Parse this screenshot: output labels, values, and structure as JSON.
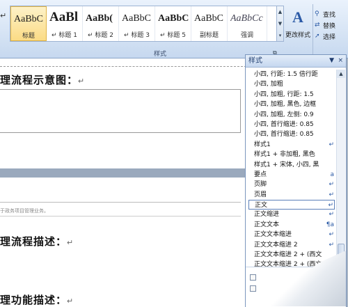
{
  "ribbon": {
    "left_glyph": "↵",
    "styles": [
      {
        "sample": "AaBbC",
        "label": "标题",
        "style": "normal"
      },
      {
        "sample": "AaBl",
        "label": "↵ 标题 1",
        "style": "big"
      },
      {
        "sample": "AaBb(",
        "label": "↵ 标题 2",
        "style": "bold"
      },
      {
        "sample": "AaBbC",
        "label": "↵ 标题 3",
        "style": "normal"
      },
      {
        "sample": "AaBbC",
        "label": "↵ 标题 5",
        "style": "bold"
      },
      {
        "sample": "AaBbC",
        "label": "副标题",
        "style": "normal"
      },
      {
        "sample": "AaBbCc",
        "label": "强调",
        "style": "ital"
      }
    ],
    "change_styles_label": "更改样式",
    "change_styles_icon": "A",
    "group_label": "样式",
    "edit": {
      "find": "查找",
      "replace": "替换",
      "select": "选择"
    }
  },
  "document": {
    "heading1": "理流程示意图：",
    "heading2": "理流程描述：",
    "heading3": "理功能描述：",
    "para_mark": "↵",
    "small_text": "于政务项目管理业务。"
  },
  "pane": {
    "title": "样式",
    "items": [
      {
        "text": "小四, 行距: 1.5 倍行距",
        "mark": ""
      },
      {
        "text": "小四, 加粗",
        "mark": ""
      },
      {
        "text": "小四, 加粗, 行距: 1.5",
        "mark": ""
      },
      {
        "text": "小四, 加粗, 黑色, 边框",
        "mark": ""
      },
      {
        "text": "小四, 加粗, 左侧: 0.9",
        "mark": ""
      },
      {
        "text": "小四, 首行缩进: 0.85",
        "mark": ""
      },
      {
        "text": "小四, 首行缩进: 0.85",
        "mark": ""
      },
      {
        "text": "样式1",
        "mark": "↵"
      },
      {
        "text": "样式1 + 非加粗, 黑色",
        "mark": ""
      },
      {
        "text": "样式1 + 宋体, 小四, 黑",
        "mark": ""
      },
      {
        "text": "要点",
        "mark": "a"
      },
      {
        "text": "页脚",
        "mark": "↵"
      },
      {
        "text": "页眉",
        "mark": "↵"
      },
      {
        "text": "正文",
        "mark": "↵"
      },
      {
        "text": "正文缩进",
        "mark": "↵"
      },
      {
        "text": "正文文本",
        "mark": "¶a"
      },
      {
        "text": "正文文本缩进",
        "mark": "↵"
      },
      {
        "text": "正文文本缩进 2",
        "mark": "↵"
      },
      {
        "text": "正文文本缩进 2 + (西文",
        "mark": ""
      },
      {
        "text": "正文文本缩进 2 + (西文",
        "mark": ""
      }
    ],
    "selected_index": 13,
    "menu_icon": "▼",
    "close_icon": "×"
  },
  "colors": {
    "ribbon_accent": "#2b5aa6",
    "selected_border": "#5b7fb8"
  }
}
